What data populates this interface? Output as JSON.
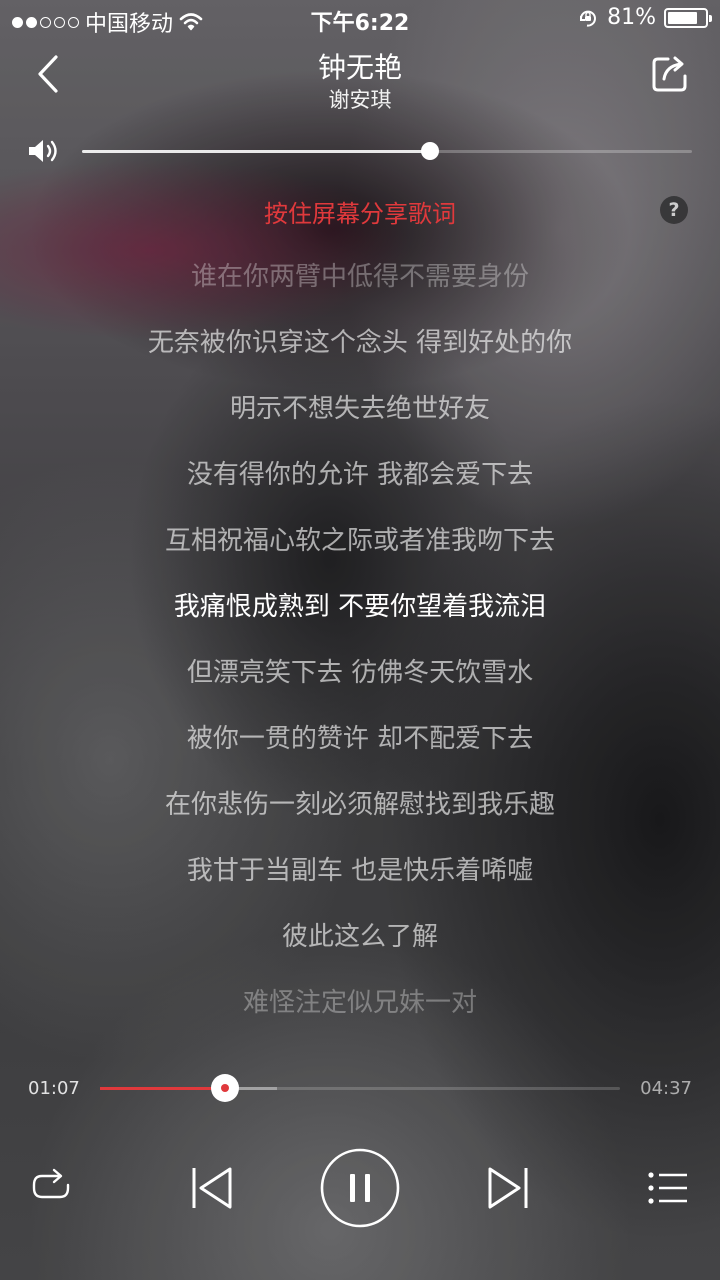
{
  "status_bar": {
    "carrier": "中国移动",
    "time": "下午6:22",
    "battery_percent": "81%",
    "battery_level": 0.81,
    "signal_bars_filled": 2,
    "signal_bars_total": 5
  },
  "header": {
    "title": "钟无艳",
    "artist": "谢安琪"
  },
  "volume": {
    "level": 0.57
  },
  "lyrics": {
    "share_hint": "按住屏幕分享歌词",
    "help_label": "?",
    "lines": [
      "谁在你两臂中低得不需要身份",
      "无奈被你识穿这个念头 得到好处的你",
      "明示不想失去绝世好友",
      "没有得你的允许 我都会爱下去",
      "互相祝福心软之际或者准我吻下去",
      "我痛恨成熟到 不要你望着我流泪",
      "但漂亮笑下去 彷佛冬天饮雪水",
      "被你一贯的赞许 却不配爱下去",
      "在你悲伤一刻必须解慰找到我乐趣",
      "我甘于当副车 也是快乐着唏嘘",
      "彼此这么了解",
      "难怪注定似兄妹一对"
    ],
    "current_index": 5
  },
  "progress": {
    "elapsed": "01:07",
    "total": "04:37",
    "played_fraction": 0.24,
    "buffered_fraction": 0.34
  },
  "colors": {
    "accent": "#e0393c"
  },
  "icons": {
    "back": "chevron-left-icon",
    "share": "share-icon",
    "speaker": "speaker-icon",
    "help": "help-icon",
    "loop": "loop-icon",
    "previous": "previous-track-icon",
    "pause": "pause-icon",
    "next": "next-track-icon",
    "playlist": "playlist-icon"
  }
}
